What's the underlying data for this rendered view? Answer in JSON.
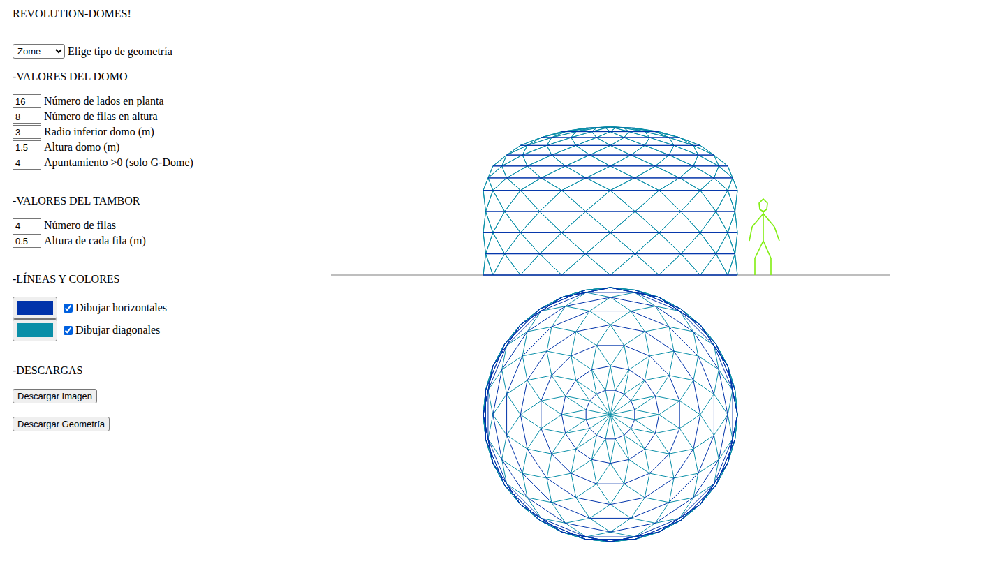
{
  "title": "REVOLUTION-DOMES!",
  "geometry": {
    "value": "Zome",
    "label": "Elige tipo de geometría"
  },
  "dome_section": {
    "heading": "-VALORES DEL DOMO",
    "fields": [
      {
        "value": "16",
        "label": "Número de lados en planta"
      },
      {
        "value": "8",
        "label": "Número de filas en altura"
      },
      {
        "value": "3",
        "label": "Radio inferior domo (m)"
      },
      {
        "value": "1.5",
        "label": "Altura domo (m)"
      },
      {
        "value": "4",
        "label": "Apuntamiento >0 (solo G-Dome)"
      }
    ]
  },
  "drum_section": {
    "heading": "-VALORES DEL TAMBOR",
    "fields": [
      {
        "value": "4",
        "label": "Número de filas"
      },
      {
        "value": "0.5",
        "label": "Altura de cada fila (m)"
      }
    ]
  },
  "lines_section": {
    "heading": "-LÍNEAS Y COLORES",
    "options": [
      {
        "label": "Dibujar horizontales",
        "color": "#0033aa",
        "checked": true
      },
      {
        "label": "Dibujar diagonales",
        "color": "#0a8fa8",
        "checked": true
      }
    ]
  },
  "downloads": {
    "heading": "-DESCARGAS",
    "buttons": [
      "Descargar Imagen",
      "Descargar Geometría"
    ]
  }
}
